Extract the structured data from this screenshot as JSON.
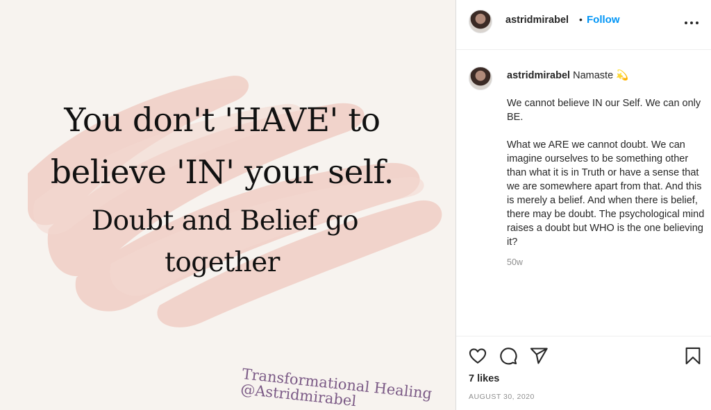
{
  "post": {
    "quote_lines": [
      "You don't 'HAVE' to",
      "believe 'IN' your self.",
      "Doubt and Belief go",
      "together"
    ],
    "credit_line1": "Transformational Healing",
    "credit_line2": "@Astridmirabel"
  },
  "header": {
    "username": "astridmirabel",
    "separator": "•",
    "follow_label": "Follow",
    "more_icon": "more-options-icon"
  },
  "caption": {
    "username": "astridmirabel",
    "title": "Namaste 💫",
    "paragraph1": "We cannot believe IN our Self. We can only BE.",
    "paragraph2": "What we ARE we cannot doubt. We can imagine ourselves to be something other than what it is in Truth or have a sense that we are somewhere apart from that. And this is merely a belief. And when there is belief, there may be doubt. The psychological mind raises a doubt but WHO is the one believing it?",
    "time_ago": "50w"
  },
  "actions": {
    "icons": [
      "heart-icon",
      "comment-icon",
      "share-icon",
      "bookmark-icon"
    ],
    "likes": "7 likes",
    "date": "AUGUST 30, 2020"
  },
  "colors": {
    "link_blue": "#0095f6",
    "muted_gray": "#8e8e8e",
    "brush_pink": "#efc9bf",
    "credit_purple": "#7b5a86"
  }
}
